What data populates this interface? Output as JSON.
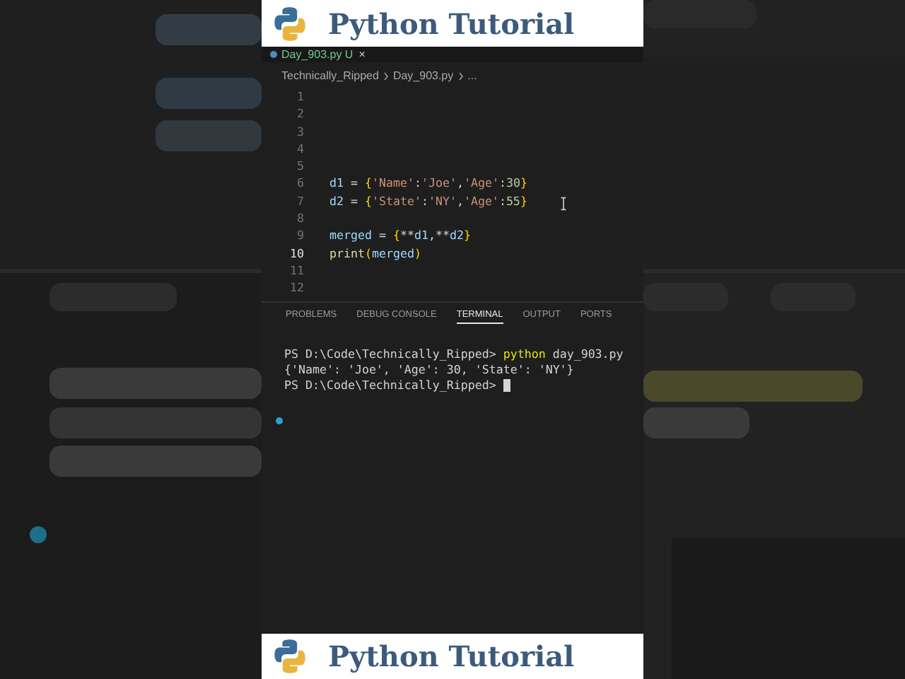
{
  "banner_top": {
    "title": "Python Tutorial"
  },
  "editor_tab": {
    "label": "Day_903.py",
    "status": "U",
    "close": "×"
  },
  "breadcrumb": [
    "Technically_Ripped",
    "Day_903.py",
    "..."
  ],
  "code_lines": [
    {
      "number": "1",
      "current": false
    },
    {
      "number": "2",
      "current": false
    },
    {
      "number": "3",
      "current": false
    },
    {
      "number": "4",
      "current": false
    },
    {
      "number": "5",
      "current": false
    },
    {
      "number": "6",
      "current": false,
      "tokens": [
        {
          "kind": "var",
          "text": "d1"
        },
        {
          "kind": "plain",
          "text": " = "
        },
        {
          "kind": "brace",
          "text": "{"
        },
        {
          "kind": "str",
          "text": "'Name'"
        },
        {
          "kind": "plain",
          "text": ":"
        },
        {
          "kind": "str",
          "text": "'Joe'"
        },
        {
          "kind": "plain",
          "text": ","
        },
        {
          "kind": "str",
          "text": "'Age'"
        },
        {
          "kind": "plain",
          "text": ":"
        },
        {
          "kind": "num",
          "text": "30"
        },
        {
          "kind": "brace",
          "text": "}"
        }
      ]
    },
    {
      "number": "7",
      "current": false,
      "tokens": [
        {
          "kind": "var",
          "text": "d2"
        },
        {
          "kind": "plain",
          "text": " = "
        },
        {
          "kind": "brace",
          "text": "{"
        },
        {
          "kind": "str",
          "text": "'State'"
        },
        {
          "kind": "plain",
          "text": ":"
        },
        {
          "kind": "str",
          "text": "'NY'"
        },
        {
          "kind": "plain",
          "text": ","
        },
        {
          "kind": "str",
          "text": "'Age'"
        },
        {
          "kind": "plain",
          "text": ":"
        },
        {
          "kind": "num",
          "text": "55"
        },
        {
          "kind": "brace",
          "text": "}"
        }
      ]
    },
    {
      "number": "8",
      "current": false
    },
    {
      "number": "9",
      "current": false,
      "tokens": [
        {
          "kind": "var",
          "text": "merged"
        },
        {
          "kind": "plain",
          "text": " = "
        },
        {
          "kind": "brace",
          "text": "{"
        },
        {
          "kind": "plain",
          "text": "**"
        },
        {
          "kind": "var",
          "text": "d1"
        },
        {
          "kind": "plain",
          "text": ",**"
        },
        {
          "kind": "var",
          "text": "d2"
        },
        {
          "kind": "brace",
          "text": "}"
        }
      ]
    },
    {
      "number": "10",
      "current": true,
      "tokens": [
        {
          "kind": "func",
          "text": "print"
        },
        {
          "kind": "brace",
          "text": "("
        },
        {
          "kind": "var",
          "text": "merged"
        },
        {
          "kind": "brace",
          "text": ")"
        }
      ]
    },
    {
      "number": "11",
      "current": false
    },
    {
      "number": "12",
      "current": false
    }
  ],
  "panel_tabs": [
    {
      "label": "PROBLEMS",
      "selected": false
    },
    {
      "label": "DEBUG CONSOLE",
      "selected": false
    },
    {
      "label": "TERMINAL",
      "selected": true
    },
    {
      "label": "OUTPUT",
      "selected": false
    },
    {
      "label": "PORTS",
      "selected": false
    }
  ],
  "terminal_lines": [
    {
      "tokens": [
        {
          "kind": "plain",
          "text": "PS D:\\Code\\Technically_Ripped> "
        },
        {
          "kind": "cmd",
          "text": "python"
        },
        {
          "kind": "plain",
          "text": " day_903.py"
        }
      ],
      "cursor": false
    },
    {
      "tokens": [
        {
          "kind": "plain",
          "text": "{'Name': 'Joe', 'Age': 30, 'State': 'NY'}"
        }
      ],
      "cursor": false
    },
    {
      "tokens": [
        {
          "kind": "plain",
          "text": "PS D:\\Code\\Technically_Ripped> "
        }
      ],
      "cursor": true
    }
  ],
  "banner_bottom": {
    "title": "Python Tutorial"
  }
}
